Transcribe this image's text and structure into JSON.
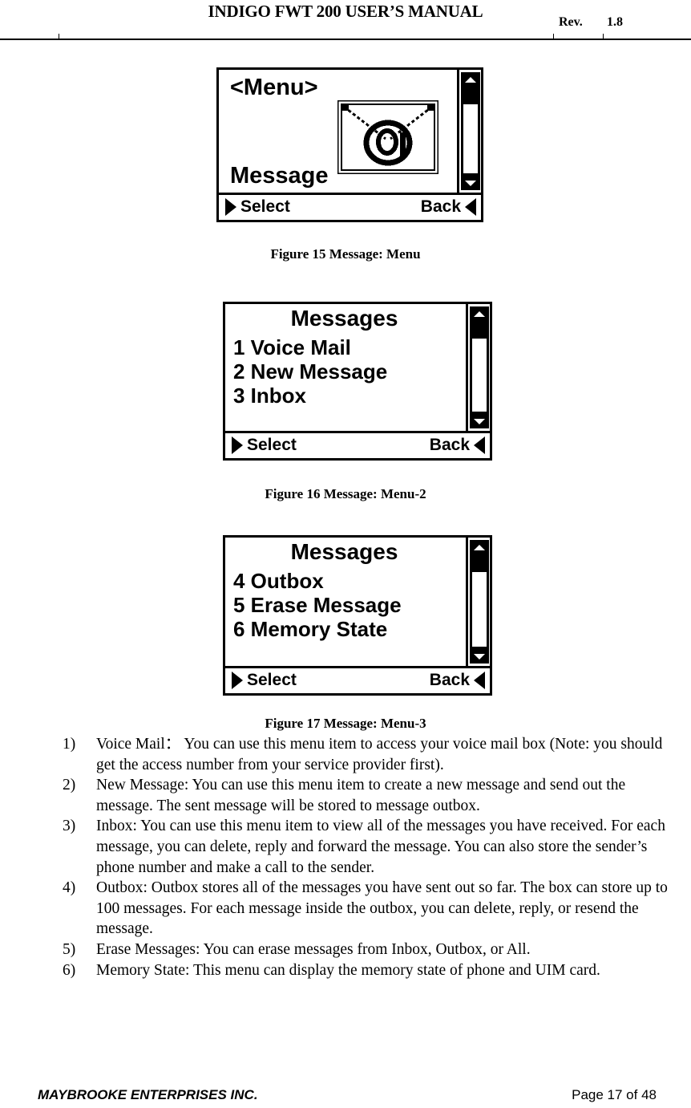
{
  "header": {
    "title": "INDIGO FWT 200 USER’S MANUAL",
    "rev_label": "Rev.",
    "rev_value": "1.8"
  },
  "figures": [
    {
      "id": "figure-15",
      "caption": "Figure 15  Message: Menu",
      "screen": {
        "type": "icon-menu",
        "title": "<Menu>",
        "item_label": "Message",
        "icon": "envelope-at-icon",
        "scrollbar": {
          "up_arrow": "scroll-up-arrow",
          "down_arrow": "scroll-down-arrow",
          "thumb_position": "top"
        },
        "softkeys": {
          "left_label": "Select",
          "left_icon": "triangle-right-icon",
          "right_label": "Back",
          "right_icon": "triangle-left-icon"
        }
      }
    },
    {
      "id": "figure-16",
      "caption": "Figure 16  Message: Menu-2",
      "screen": {
        "type": "list-menu",
        "title": "Messages",
        "items": [
          "1 Voice Mail",
          "2 New Message",
          "3 Inbox"
        ],
        "scrollbar": {
          "up_arrow": "scroll-up-arrow",
          "down_arrow": "scroll-down-arrow",
          "thumb_position": "top"
        },
        "softkeys": {
          "left_label": "Select",
          "left_icon": "triangle-right-icon",
          "right_label": "Back",
          "right_icon": "triangle-left-icon"
        }
      }
    },
    {
      "id": "figure-17",
      "caption": "Figure 17  Message: Menu-3",
      "screen": {
        "type": "list-menu",
        "title": "Messages",
        "items": [
          "4 Outbox",
          "5 Erase Message",
          "6 Memory State"
        ],
        "scrollbar": {
          "up_arrow": "scroll-up-arrow",
          "down_arrow": "scroll-down-arrow",
          "thumb_position": "top"
        },
        "softkeys": {
          "left_label": "Select",
          "left_icon": "triangle-right-icon",
          "right_label": "Back",
          "right_icon": "triangle-left-icon"
        }
      }
    }
  ],
  "body_list": [
    {
      "number": "1)",
      "text": "Voice Mail： You can use this menu item to access your voice mail box (Note: you should get the access number from your service provider first)."
    },
    {
      "number": "2)",
      "text": "New Message: You can use this menu item to create a new message and send out the message. The sent message will be stored to message outbox."
    },
    {
      "number": "3)",
      "text": "Inbox: You can use this menu item to view all of the messages you have received. For each message, you can delete, reply and forward the message. You can also store the sender’s phone number and make a call to the sender."
    },
    {
      "number": "4)",
      "text": "Outbox: Outbox stores all of the messages you have sent out so far. The box can store up to 100 messages. For each message inside the outbox, you can delete, reply, or resend the message."
    },
    {
      "number": "5)",
      "text": "Erase Messages: You can erase messages from Inbox, Outbox, or All."
    },
    {
      "number": "6)",
      "text": "Memory State: This menu can display the memory state of phone and UIM card."
    }
  ],
  "footer": {
    "company": "MAYBROOKE ENTERPRISES INC.",
    "page": "Page 17 of 48"
  }
}
